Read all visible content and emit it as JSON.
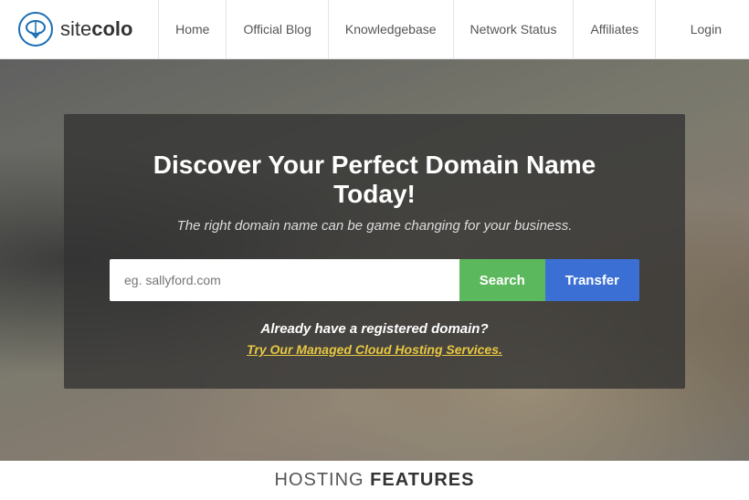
{
  "header": {
    "logo_text_light": "site",
    "logo_text_bold": "colo",
    "nav_items": [
      {
        "label": "Home",
        "id": "home"
      },
      {
        "label": "Official Blog",
        "id": "official-blog"
      },
      {
        "label": "Knowledgebase",
        "id": "knowledgebase"
      },
      {
        "label": "Network Status",
        "id": "network-status"
      },
      {
        "label": "Affiliates",
        "id": "affiliates"
      }
    ],
    "login_label": "Login"
  },
  "hero": {
    "title": "Discover Your Perfect Domain Name Today!",
    "subtitle": "The right domain name can be game changing for your business.",
    "search_placeholder": "eg. sallyford.com",
    "search_button_label": "Search",
    "transfer_button_label": "Transfer",
    "registered_text": "Already have a registered domain?",
    "managed_link_text": "Try Our Managed Cloud Hosting Services."
  },
  "bottom": {
    "hosting_label_light": "HOSTING ",
    "hosting_label_bold": "FEATURES"
  }
}
